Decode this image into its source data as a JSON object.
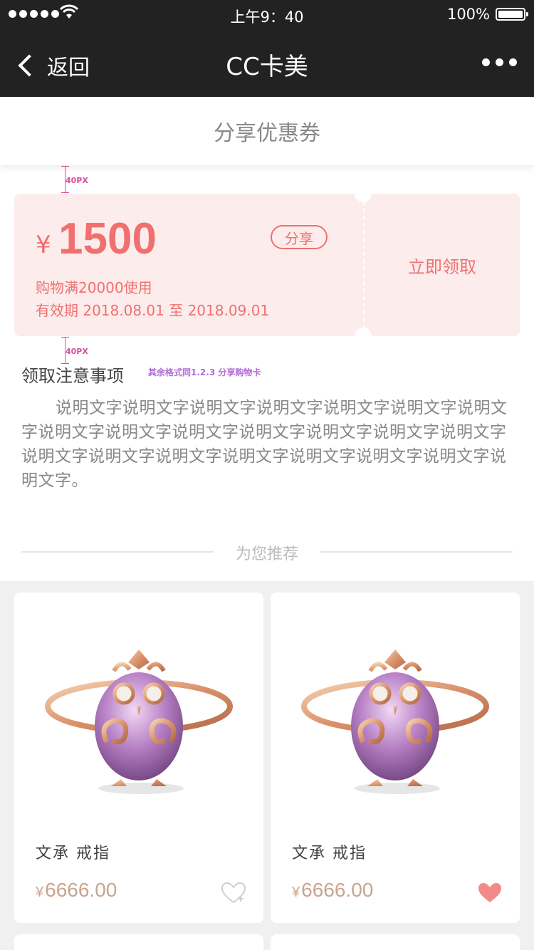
{
  "status_bar": {
    "carrier_dots": 5,
    "time": "上午9：40",
    "battery_pct": "100%"
  },
  "nav": {
    "back_label": "返回",
    "title": "CC卡美"
  },
  "section_header": {
    "title": "分享优惠券"
  },
  "annotations": {
    "spacing_top": "40PX",
    "spacing_bottom": "40PX",
    "format_tip": "其余格式同1.2.3 分享购物卡"
  },
  "coupon": {
    "currency": "¥",
    "amount": "1500",
    "share_label": "分享",
    "condition": "购物满20000使用",
    "validity": "有效期 2018.08.01 至 2018.09.01",
    "claim_label": "立即领取",
    "accent": "#f07070",
    "background": "#fdecec"
  },
  "notes": {
    "title": "领取注意事项",
    "body": "说明文字说明文字说明文字说明文字说明文字说明文字说明文字说明文字说明文字说明文字说明文字说明文字说明文字说明文字说明文字说明文字说明文字说明文字说明文字说明文字说明文字说明文字。"
  },
  "recommend": {
    "label": "为您推荐"
  },
  "products": [
    {
      "name": "文承  戒指",
      "currency": "¥",
      "price": "6666.00",
      "favorited": false
    },
    {
      "name": "文承  戒指",
      "currency": "¥",
      "price": "6666.00",
      "favorited": true
    }
  ]
}
